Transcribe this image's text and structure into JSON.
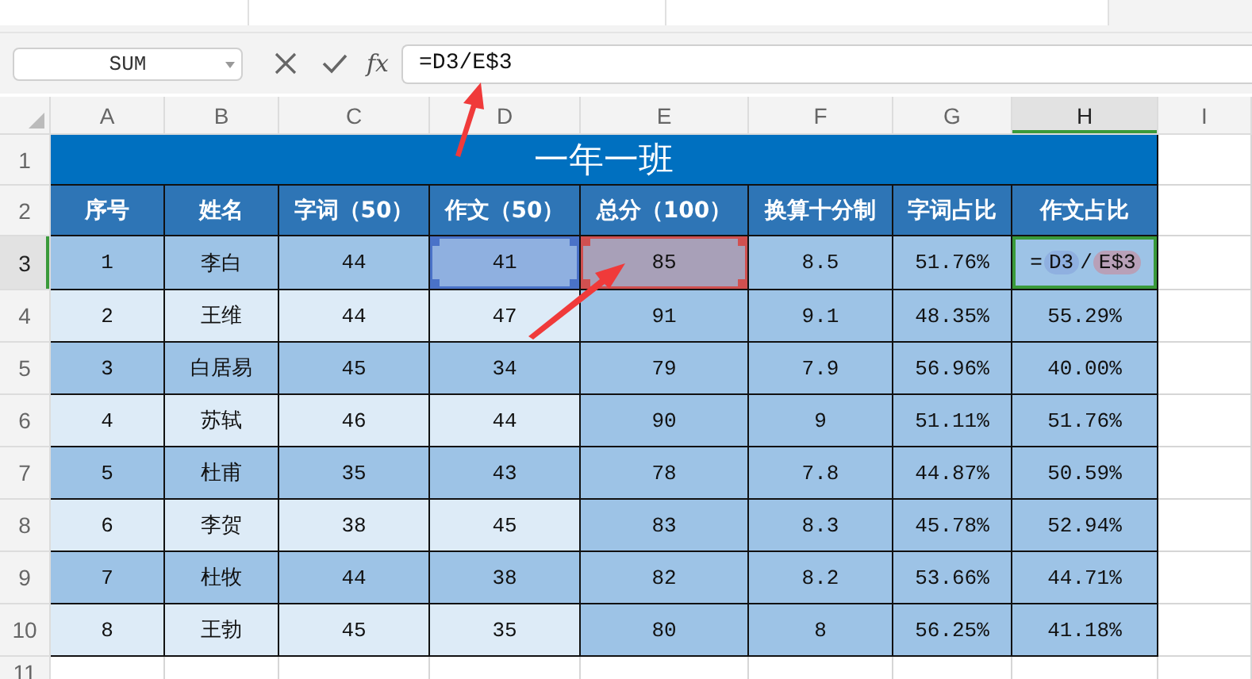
{
  "formula_bar": {
    "name_box": "SUM",
    "function_label": "fx",
    "formula": "=D3/E$3"
  },
  "sheet": {
    "columns": [
      {
        "label": "A",
        "selected": false
      },
      {
        "label": "B",
        "selected": false
      },
      {
        "label": "C",
        "selected": false
      },
      {
        "label": "D",
        "selected": false
      },
      {
        "label": "E",
        "selected": false
      },
      {
        "label": "F",
        "selected": false
      },
      {
        "label": "G",
        "selected": false
      },
      {
        "label": "H",
        "selected": true
      },
      {
        "label": "I",
        "selected": false
      }
    ],
    "title_row": {
      "number": "1",
      "selected": false,
      "title": "一年一班"
    },
    "header_row": {
      "number": "2",
      "selected": false,
      "headers": [
        "序号",
        "姓名",
        "字词（50）",
        "作文（50）",
        "总分（100）",
        "换算十分制",
        "字词占比",
        "作文占比"
      ]
    },
    "rows": [
      {
        "number": "3",
        "selected": true,
        "light_band": false,
        "cells": [
          "1",
          "李白",
          "44",
          {
            "text": "41",
            "color": "#8fb0e0"
          },
          {
            "text": "85",
            "color": "#a8a0b8"
          },
          "8.5",
          "51.76%",
          {
            "tokens": [
              {
                "text": "=",
                "kind": "operator"
              },
              {
                "text": "D3",
                "kind": "ref-first"
              },
              {
                "text": "/",
                "kind": "operator"
              },
              {
                "text": "E$3",
                "kind": "ref-second"
              }
            ]
          }
        ]
      },
      {
        "number": "4",
        "selected": false,
        "light_band": true,
        "cells": [
          "2",
          "王维",
          "44",
          "47",
          "91",
          "9.1",
          "48.35%",
          "55.29%"
        ]
      },
      {
        "number": "5",
        "selected": false,
        "light_band": false,
        "cells": [
          "3",
          "白居易",
          "45",
          "34",
          "79",
          "7.9",
          "56.96%",
          "40.00%"
        ]
      },
      {
        "number": "6",
        "selected": false,
        "light_band": true,
        "cells": [
          "4",
          "苏轼",
          "46",
          "44",
          "90",
          "9",
          "51.11%",
          "51.76%"
        ]
      },
      {
        "number": "7",
        "selected": false,
        "light_band": false,
        "cells": [
          "5",
          "杜甫",
          "35",
          "43",
          "78",
          "7.8",
          "44.87%",
          "50.59%"
        ]
      },
      {
        "number": "8",
        "selected": false,
        "light_band": true,
        "cells": [
          "6",
          "李贺",
          "38",
          "45",
          "83",
          "8.3",
          "45.78%",
          "52.94%"
        ]
      },
      {
        "number": "9",
        "selected": false,
        "light_band": false,
        "cells": [
          "7",
          "杜牧",
          "44",
          "38",
          "82",
          "8.2",
          "53.66%",
          "44.71%"
        ]
      },
      {
        "number": "10",
        "selected": false,
        "light_band": true,
        "cells": [
          "8",
          "王勃",
          "45",
          "35",
          "80",
          "8",
          "56.25%",
          "41.18%"
        ]
      }
    ],
    "empty_row": {
      "number": "11",
      "selected": false
    }
  }
}
